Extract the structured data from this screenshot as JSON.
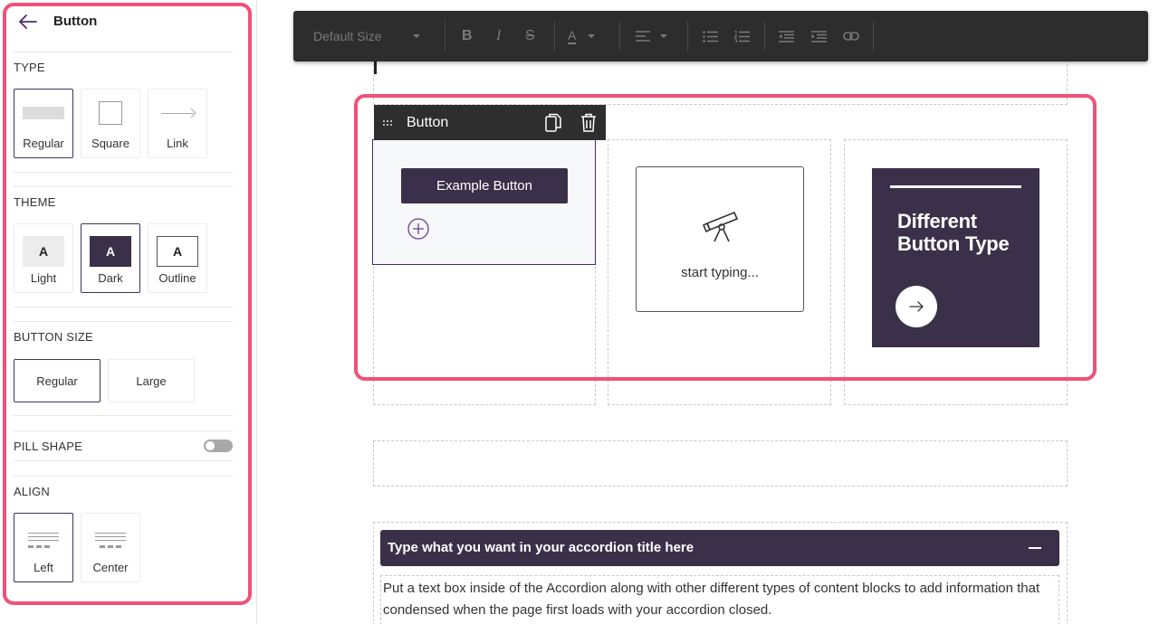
{
  "sidebar": {
    "title": "Button",
    "sections": {
      "type": "TYPE",
      "theme": "THEME",
      "button_size": "BUTTON SIZE",
      "pill_shape": "PILL SHAPE",
      "align": "ALIGN"
    },
    "type_options": [
      "Regular",
      "Square",
      "Link"
    ],
    "type_selected": "Regular",
    "theme_options": [
      {
        "label": "Light",
        "glyph": "A"
      },
      {
        "label": "Dark",
        "glyph": "A"
      },
      {
        "label": "Outline",
        "glyph": "A"
      }
    ],
    "theme_selected": "Dark",
    "size_options": [
      "Regular",
      "Large"
    ],
    "size_selected": "Regular",
    "pill_shape_on": false,
    "align_options": [
      "Left",
      "Center"
    ],
    "align_selected": "Left"
  },
  "toolbar": {
    "font_size": "Default Size",
    "text_color_glyph": "A",
    "bold_glyph": "B",
    "italic_glyph": "I",
    "strike_glyph": "S"
  },
  "block": {
    "bar_title": "Button",
    "example_button": "Example Button",
    "empty_text": "start typing...",
    "feature_title": "Different Button Type"
  },
  "accordion": {
    "title": "Type what you want in your accordion title here",
    "body": "Put a text box inside of the Accordion along with other different types of content blocks to add information that condensed when the page first loads with your accordion closed."
  },
  "colors": {
    "accent_highlight": "#f0517a",
    "brand_dark": "#3b3049",
    "toolbar_bg": "#2d2d2d"
  }
}
